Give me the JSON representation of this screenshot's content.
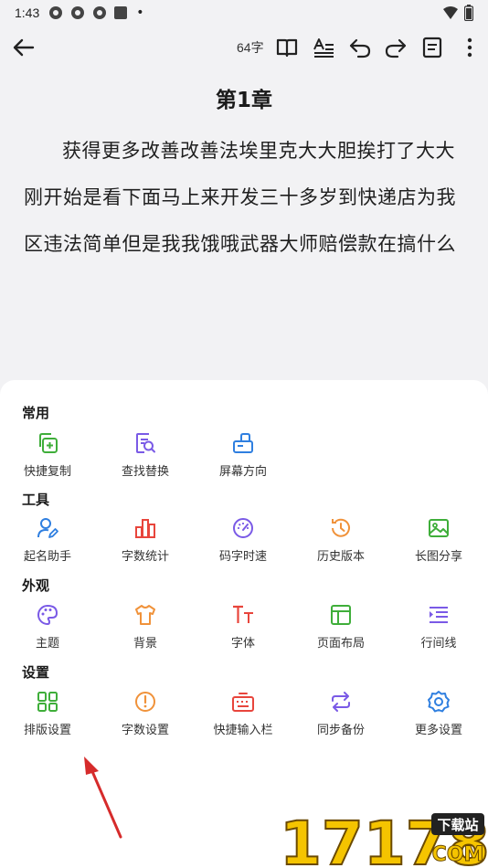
{
  "status": {
    "time": "1:43",
    "dot": "•"
  },
  "toolbar": {
    "word_count": "64字"
  },
  "chapter": {
    "title": "第1章",
    "body": "获得更多改善改善法埃里克大大胆挨打了大大刚开始是看下面马上来开发三十多岁到快递店为我区违法简单但是我我饿哦武器大师赔偿款在搞什么"
  },
  "sections": {
    "common": {
      "title": "常用",
      "items": [
        "快捷复制",
        "查找替换",
        "屏幕方向"
      ]
    },
    "tools": {
      "title": "工具",
      "items": [
        "起名助手",
        "字数统计",
        "码字时速",
        "历史版本",
        "长图分享"
      ]
    },
    "appearance": {
      "title": "外观",
      "items": [
        "主题",
        "背景",
        "字体",
        "页面布局",
        "行间线"
      ]
    },
    "settings": {
      "title": "设置",
      "items": [
        "排版设置",
        "字数设置",
        "快捷输入栏",
        "同步备份",
        "更多设置"
      ]
    }
  },
  "colors": {
    "green": "#3fae3a",
    "purple": "#7a5ae6",
    "blue": "#2f7fe0",
    "red": "#e8453c",
    "orange": "#f0923a",
    "arrow": "#d62b2b"
  },
  "watermark": {
    "digits": "17178",
    "badge": "下载站",
    "domain": "COM"
  }
}
